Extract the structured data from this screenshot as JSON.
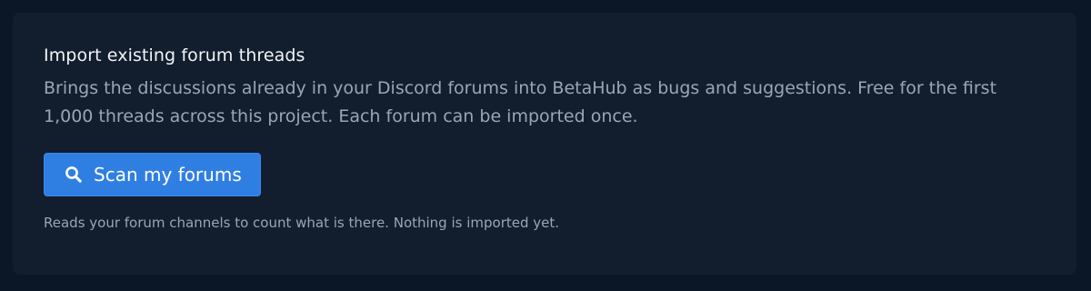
{
  "import_card": {
    "title": "Import existing forum threads",
    "description": "Brings the discussions already in your Discord forums into BetaHub as bugs and suggestions. Free for the first 1,000 threads across this project. Each forum can be imported once.",
    "scan_button": {
      "label": "Scan my forums",
      "icon": "search-icon"
    },
    "hint": "Reads your forum channels to count what is there. Nothing is imported yet."
  },
  "colors": {
    "page_background": "#0b1626",
    "card_background": "#121d2e",
    "accent": "#2f7fe3",
    "title_text": "#f1f4f8",
    "muted_text": "#9aa5b6"
  }
}
